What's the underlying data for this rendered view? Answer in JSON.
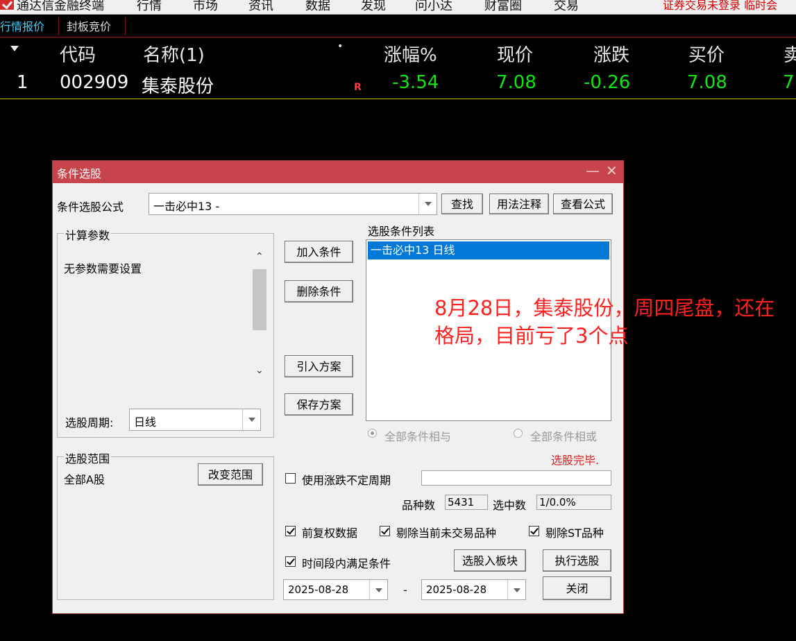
{
  "menubar": {
    "app_title": "通达信金融终端",
    "items": [
      "行情",
      "市场",
      "资讯",
      "数据",
      "发现",
      "问小达",
      "财富圈",
      "交易"
    ],
    "warning": "证券交易未登录  临时会"
  },
  "tabs": [
    "行情报价",
    "封板竞价"
  ],
  "quote_table": {
    "headers": [
      "代码",
      "名称(1)",
      "•",
      "涨幅%",
      "现价",
      "涨跌",
      "买价",
      "卖"
    ],
    "rows": [
      {
        "index": "1",
        "code": "002909",
        "name": "集泰股份",
        "mark": "R",
        "change_pct": "-3.54",
        "price": "7.08",
        "change": "-0.26",
        "bid": "7.08",
        "ask": "7."
      }
    ]
  },
  "dialog": {
    "title": "条件选股",
    "formula_label": "条件选股公式",
    "formula_value": "一击必中13  -",
    "btn_find": "查找",
    "btn_usage": "用法注释",
    "btn_view": "查看公式",
    "params_group": "计算参数",
    "params_text": "无参数需要设置",
    "period_label": "选股周期:",
    "period_value": "日线",
    "scope_group": "选股范围",
    "scope_value": "全部A股",
    "btn_change_scope": "改变范围",
    "btn_add": "加入条件",
    "btn_delete": "删除条件",
    "btn_import": "引入方案",
    "btn_save": "保存方案",
    "condition_list_label": "选股条件列表",
    "conditions": [
      "一击必中13  日线"
    ],
    "radio_and": "全部条件相与",
    "radio_or": "全部条件相或",
    "status": "选股完毕.",
    "use_indefinite_label": "使用涨跌不定周期",
    "count_label": "品种数",
    "count_value": "5431",
    "selected_label": "选中数",
    "selected_value": "1/0.0%",
    "cb_restore": "前复权数据",
    "cb_exclude_untraded": "剔除当前未交易品种",
    "cb_exclude_st": "剔除ST品种",
    "cb_time_range": "时间段内满足条件",
    "btn_to_block": "选股入板块",
    "btn_execute": "执行选股",
    "date_from": "2025-08-28",
    "date_dash": "-",
    "date_to": "2025-08-28",
    "btn_close": "关闭"
  },
  "annotation": "8月28日，集泰股份，周四尾盘，还在格局，目前亏了3个点",
  "colors": {
    "accent_red": "#c7444a",
    "down_green": "#12e612",
    "note_red": "#ff2020",
    "select_blue": "#0078d7"
  }
}
